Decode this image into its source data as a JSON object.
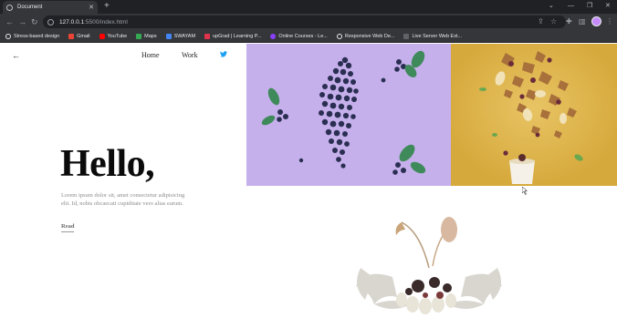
{
  "browser": {
    "tab_title": "Document",
    "url_host": "127.0.0.1",
    "url_path": ":5500/index.html",
    "bookmarks": [
      {
        "label": "Stress-based design",
        "color": "#e8eaed"
      },
      {
        "label": "Gmail",
        "color": "#ea4335"
      },
      {
        "label": "YouTube",
        "color": "#ff0000"
      },
      {
        "label": "Maps",
        "color": "#34a853"
      },
      {
        "label": "SWAYAM",
        "color": "#4285f4"
      },
      {
        "label": "upGrad | Learning P...",
        "color": "#e0334c"
      },
      {
        "label": "Online Courses - Le...",
        "color": "#8a3ffc"
      },
      {
        "label": "Responsive Web De...",
        "color": "#e8eaed"
      },
      {
        "label": "Live Server Web Ext...",
        "color": "#9aa0a6"
      }
    ]
  },
  "site": {
    "nav": {
      "home": "Home",
      "work": "Work"
    },
    "hero": {
      "heading": "Hello,",
      "body": "Lorem ipsum dolor sit, amet consectetur adipisicing elit. Id, nobis obcaecati cupiditate vero alias earum.",
      "link": "Read"
    },
    "accent_color": "#1da1f2"
  }
}
